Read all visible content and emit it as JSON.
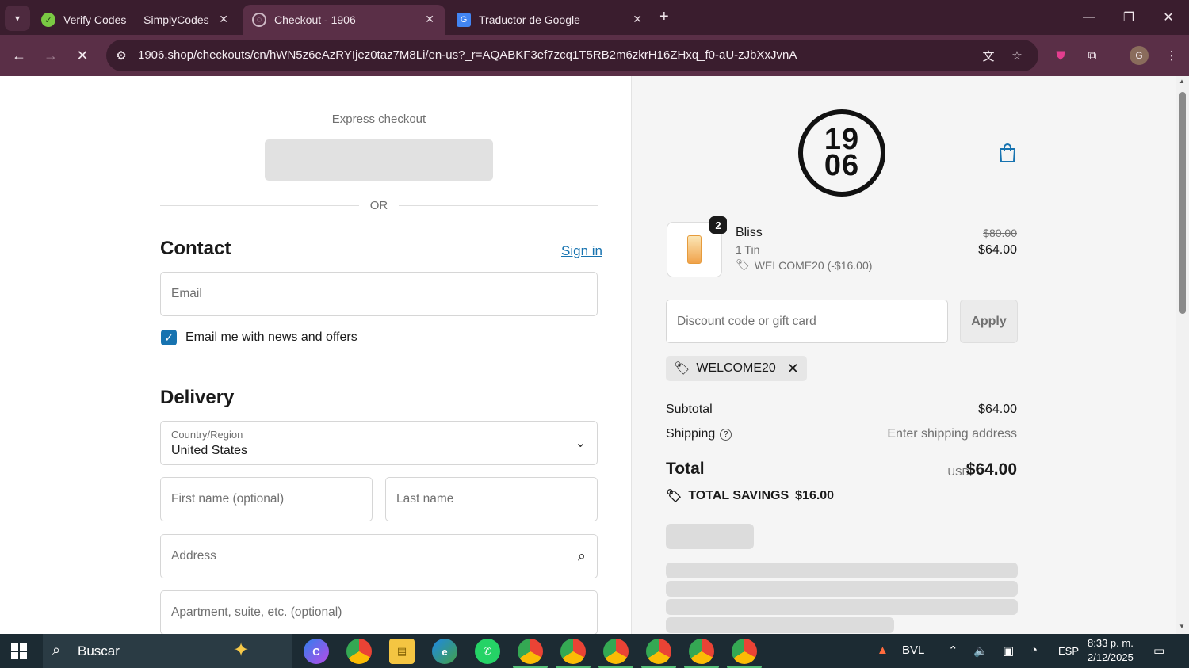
{
  "browser": {
    "tabs": [
      {
        "title": "Verify Codes — SimplyCodes",
        "active": false
      },
      {
        "title": "Checkout - 1906",
        "active": true
      },
      {
        "title": "Traductor de Google",
        "active": false
      }
    ],
    "url": "1906.shop/checkouts/cn/hWN5z6eAzRYIjez0taz7M8Li/en-us?_r=AQABKF3ef7zcq1T5RB2m6zkrH16ZHxq_f0-aU-zJbXxJvnA",
    "profile_initial": "G"
  },
  "checkout": {
    "express_label": "Express checkout",
    "or_text": "OR",
    "contact": {
      "heading": "Contact",
      "sign_in": "Sign in",
      "email_placeholder": "Email",
      "newsletter_label": "Email me with news and offers",
      "newsletter_checked": true
    },
    "delivery": {
      "heading": "Delivery",
      "country_label": "Country/Region",
      "country_value": "United States",
      "first_name_placeholder": "First name (optional)",
      "last_name_placeholder": "Last name",
      "address_placeholder": "Address",
      "apartment_placeholder": "Apartment, suite, etc. (optional)"
    }
  },
  "summary": {
    "logo_top": "19",
    "logo_bottom": "06",
    "item": {
      "quantity": "2",
      "name": "Bliss",
      "variant": "1 Tin",
      "discount": "WELCOME20 (-$16.00)",
      "original_price": "$80.00",
      "price": "$64.00"
    },
    "discount_placeholder": "Discount code or gift card",
    "apply_label": "Apply",
    "applied_code": "WELCOME20",
    "subtotal_label": "Subtotal",
    "subtotal_value": "$64.00",
    "shipping_label": "Shipping",
    "shipping_value": "Enter shipping address",
    "total_label": "Total",
    "total_currency": "USD",
    "total_value": "$64.00",
    "savings_label": "TOTAL SAVINGS",
    "savings_value": "$16.00"
  },
  "taskbar": {
    "search_text": "Buscar",
    "weather": "BVL",
    "language": "ESP",
    "time": "8:33 p. m.",
    "date": "2/12/2025"
  },
  "colors": {
    "accent": "#1773b0",
    "chrome_dark": "#3a1d2e",
    "chrome_active": "#5a2f47"
  }
}
